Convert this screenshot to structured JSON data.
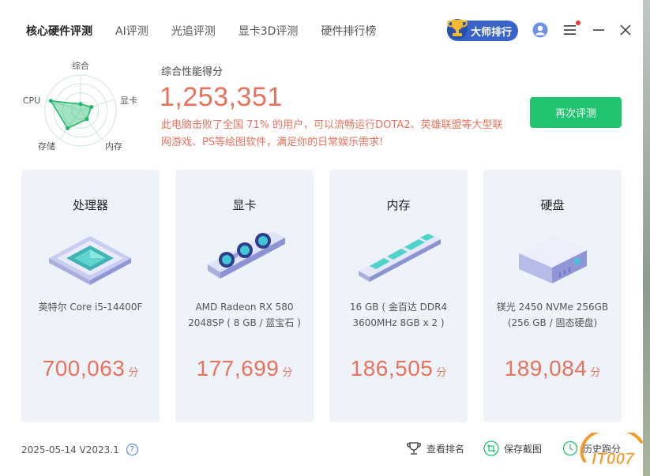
{
  "nav": {
    "tabs": [
      "核心硬件评测",
      "AI评测",
      "光追评测",
      "显卡3D评测",
      "硬件排行榜"
    ],
    "active_index": 0
  },
  "header": {
    "master_label": "大师排行",
    "icons": [
      "trophy-icon",
      "user-icon",
      "menu-icon",
      "minimize-icon",
      "close-icon"
    ],
    "notification_dot_color": "#e53935"
  },
  "radar": {
    "labels": [
      "综合",
      "显卡",
      "内存",
      "存储",
      "CPU"
    ],
    "values": [
      0.18,
      0.32,
      0.3,
      0.62,
      0.88
    ]
  },
  "summary": {
    "label": "综合性能得分",
    "score": "1,253,351",
    "desc": "此电脑击败了全国 71% 的用户，可以流畅运行DOTA2、英雄联盟等大型联网游戏、PS等绘图软件，满足你的日常娱乐需求!",
    "retest_label": "再次评测"
  },
  "cards": [
    {
      "title": "处理器",
      "icon": "cpu-chip-icon",
      "desc": "英特尔 Core i5-14400F",
      "score": "700,063",
      "unit": "分"
    },
    {
      "title": "显卡",
      "icon": "graphics-card-icon",
      "desc": "AMD Radeon RX 580 2048SP ( 8 GB / 蓝宝石 )",
      "score": "177,699",
      "unit": "分"
    },
    {
      "title": "内存",
      "icon": "memory-stick-icon",
      "desc": "16 GB ( 金百达 DDR4 3600MHz 8GB x 2 )",
      "score": "186,505",
      "unit": "分"
    },
    {
      "title": "硬盘",
      "icon": "hard-drive-icon",
      "desc": "镁光 2450 NVMe 256GB (256 GB / 固态硬盘)",
      "score": "189,084",
      "unit": "分"
    }
  ],
  "footer": {
    "version": "2025-05-14 V2023.1",
    "help_glyph": "?",
    "actions": [
      {
        "label": "查看排名",
        "icon": "trophy-outline-icon"
      },
      {
        "label": "保存截图",
        "icon": "crop-icon"
      },
      {
        "label": "历史跑分",
        "icon": "clock-icon"
      }
    ]
  },
  "watermark": {
    "text": "IT007"
  },
  "colors": {
    "accent": "#e8725c",
    "green": "#20c36f",
    "card_bg": "#eef3fa",
    "master": "#3a63c9"
  }
}
